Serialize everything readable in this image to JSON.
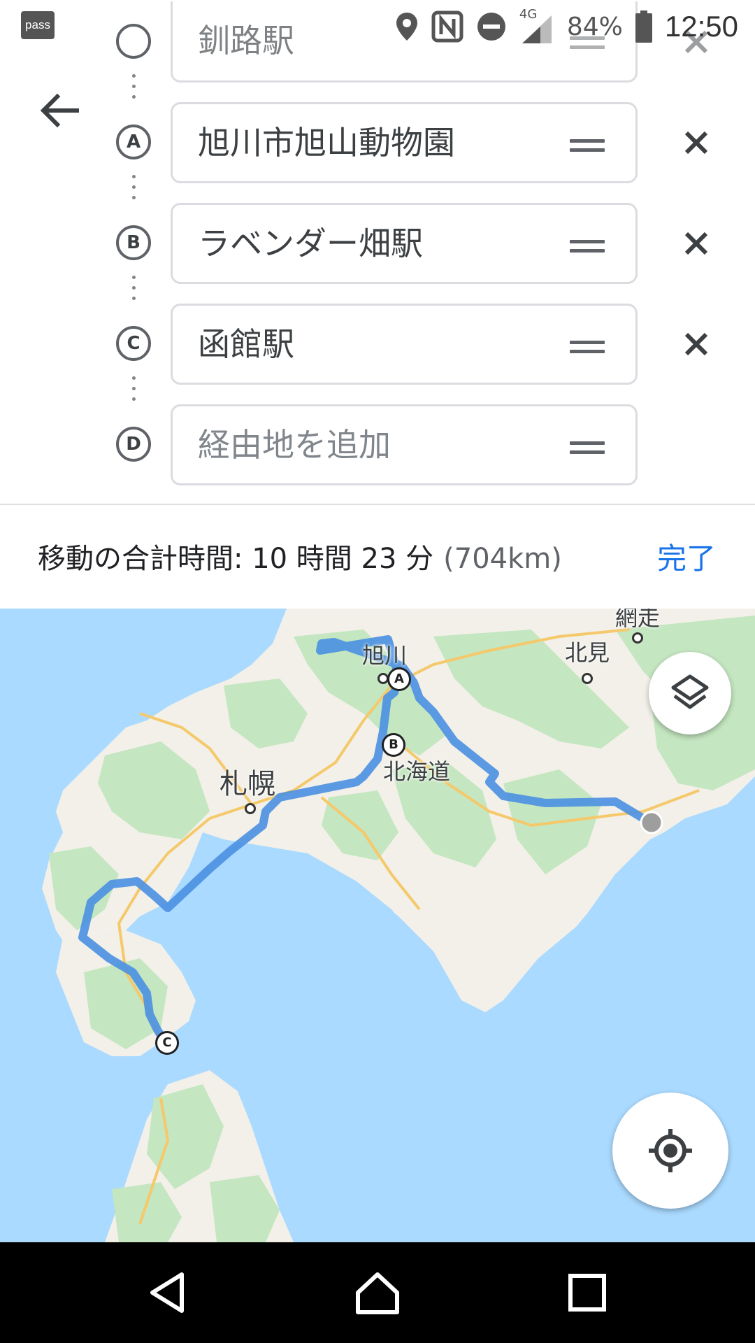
{
  "status_bar": {
    "app_badge": "pass",
    "network": "4G",
    "battery": "84%",
    "time": "12:50"
  },
  "directions": {
    "stops": [
      {
        "marker": "",
        "value": "釧路駅",
        "is_placeholder": false
      },
      {
        "marker": "A",
        "value": "旭川市旭山動物園",
        "is_placeholder": false
      },
      {
        "marker": "B",
        "value": "ラベンダー畑駅",
        "is_placeholder": false
      },
      {
        "marker": "C",
        "value": "函館駅",
        "is_placeholder": false
      },
      {
        "marker": "D",
        "value": "経由地を追加",
        "is_placeholder": true
      }
    ]
  },
  "summary": {
    "total_time": "移動の合計時間: 10 時間 23 分",
    "distance": "(704km)",
    "done_label": "完了"
  },
  "map": {
    "labels": {
      "asahikawa": "旭川",
      "abashiri": "網走",
      "kitami": "北見",
      "hokkaido": "北海道",
      "sapporo": "札幌"
    },
    "pins": {
      "a": "A",
      "b": "B",
      "c": "C"
    },
    "route_color": "#4a90e2",
    "water_color": "#aadaff",
    "land_color": "#f2f0e8",
    "forest_color": "#c4e6c0"
  }
}
